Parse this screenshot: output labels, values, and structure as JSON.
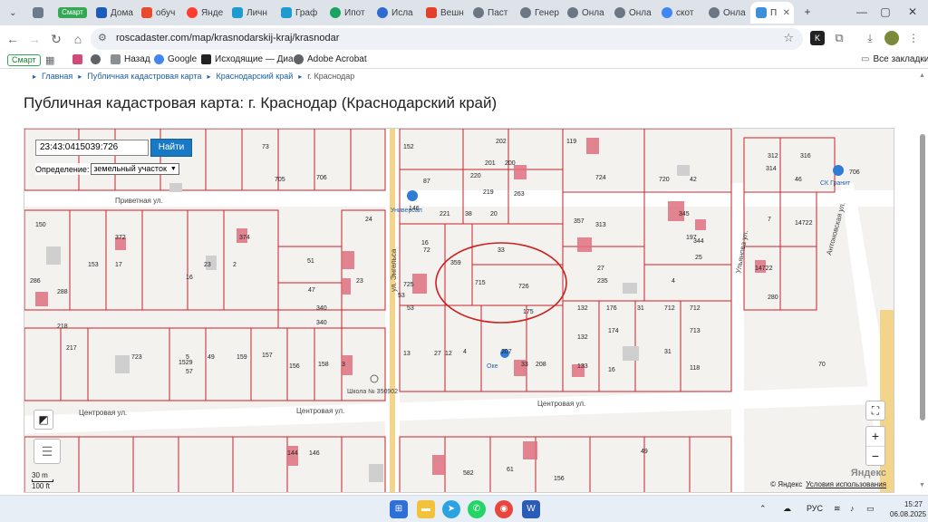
{
  "browser": {
    "tabs": [
      {
        "label": "",
        "color": "#6a7b8c"
      },
      {
        "label": "Смарт",
        "color": "#34a853"
      },
      {
        "label": "Дома",
        "color": "#1e5bb8"
      },
      {
        "label": "обуч",
        "color": "#e84a2f"
      },
      {
        "label": "Янде",
        "color": "#ff3d2e"
      },
      {
        "label": "Личн",
        "color": "#1d9bd1"
      },
      {
        "label": "Граф",
        "color": "#1d9bd1"
      },
      {
        "label": "Ипот",
        "color": "#1aa260"
      },
      {
        "label": "Исла",
        "color": "#2f6ad0"
      },
      {
        "label": "Вешн",
        "color": "#e2402b"
      },
      {
        "label": "Паст",
        "color": "#6b7785"
      },
      {
        "label": "Генер",
        "color": "#6b7785"
      },
      {
        "label": "Онла",
        "color": "#6b7785"
      },
      {
        "label": "Онла",
        "color": "#6b7785"
      },
      {
        "label": "скот",
        "color": "#4285f4"
      },
      {
        "label": "Онла",
        "color": "#6b7785"
      },
      {
        "label": "П",
        "color": "#3d8fd8"
      }
    ],
    "new_tab": "+",
    "window_controls": {
      "minimize": "—",
      "maximize": "▢",
      "close": "✕"
    },
    "url": "roscadaster.com/map/krasnodarskij-kraj/krasnodar",
    "bookmarks": [
      {
        "label": "Смарт"
      },
      {
        "label": ""
      },
      {
        "label": ""
      },
      {
        "label": "Назад"
      },
      {
        "label": "Google"
      },
      {
        "label": "Исходящие — Диа..."
      },
      {
        "label": "Adobe Acrobat"
      }
    ],
    "all_bookmarks": "Все закладки"
  },
  "page": {
    "breadcrumbs": [
      "Главная",
      "Публичная кадастровая карта",
      "Краснодарский край",
      "г. Краснодар"
    ],
    "title": "Публичная кадастровая карта: г. Краснодар (Краснодарский край)"
  },
  "map": {
    "search_value": "23:43:0415039:726",
    "find_button": "Найти",
    "definition_label": "Определение:",
    "definition_value": "земельный участок",
    "streets": {
      "privetnaya": "Приветная ул.",
      "centralnaya_left": "Центровая ул.",
      "centralnaya_mid": "Центровая ул.",
      "centralnaya_right": "Центровая ул.",
      "vertical_mid": "ул. Энгельса",
      "antonovskaya": "Антоновская ул.",
      "right_vertical": "Ульянова ул."
    },
    "pois": {
      "univermag": "Универсал",
      "sk_granit": "СК Гранит",
      "school": "Школа № 350902",
      "ocean": "Оке"
    },
    "parcel_numbers": [
      "73",
      "705",
      "706",
      "152",
      "202",
      "200",
      "87",
      "201",
      "219",
      "220",
      "263",
      "146",
      "38",
      "20",
      "221",
      "16",
      "72",
      "33",
      "359",
      "715",
      "726",
      "51",
      "47",
      "340",
      "340",
      "23",
      "150",
      "153",
      "17",
      "23",
      "2",
      "16",
      "372",
      "374",
      "288",
      "286",
      "24",
      "218",
      "217",
      "723",
      "5",
      "57",
      "49",
      "159",
      "157",
      "156",
      "158",
      "3",
      "725",
      "53",
      "53",
      "13",
      "27",
      "12",
      "4",
      "207",
      "33",
      "208",
      "175",
      "132",
      "176",
      "132",
      "174",
      "133",
      "16",
      "31",
      "712",
      "712",
      "713",
      "31",
      "118",
      "119",
      "724",
      "720",
      "42",
      "345",
      "197",
      "344",
      "25",
      "4",
      "27",
      "235",
      "357",
      "313",
      "312",
      "314",
      "316",
      "46",
      "7",
      "280",
      "14722",
      "14722",
      "1529",
      "70",
      "706",
      "144",
      "146",
      "582",
      "61",
      "156",
      "49"
    ],
    "scale": {
      "m": "30 m",
      "ft": "100 ft"
    },
    "attribution": "© Яндекс",
    "terms": "Условия использования",
    "logo": "Яндекс",
    "zoom_in": "+",
    "zoom_out": "−",
    "fullscreen": "⛶"
  },
  "taskbar": {
    "language": "РУС",
    "time": "15:27",
    "date": "06.08.2025"
  },
  "colors": {
    "parcel_border": "#c8232c",
    "building": "#e07080",
    "street": "#ffffff",
    "highlight": "#cc2020",
    "accent": "#1a79c4"
  }
}
